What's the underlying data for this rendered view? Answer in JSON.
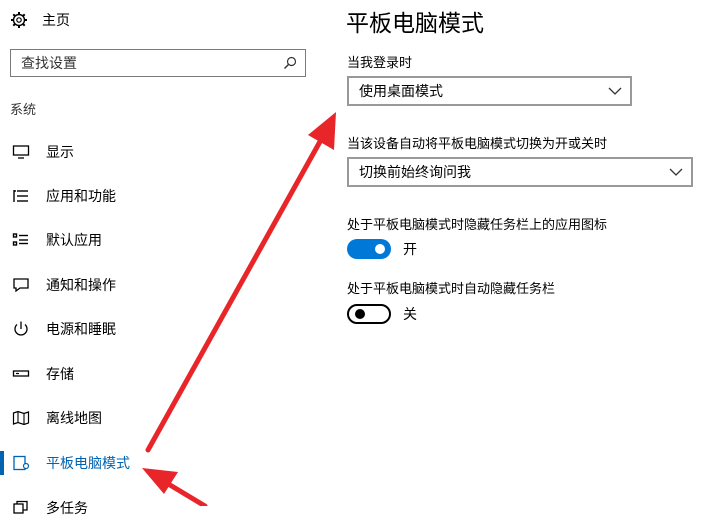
{
  "sidebar": {
    "home_label": "主页",
    "search_placeholder": "查找设置",
    "section_label": "系统",
    "items": [
      {
        "label": "显示",
        "icon": "monitor-icon"
      },
      {
        "label": "应用和功能",
        "icon": "list-icon"
      },
      {
        "label": "默认应用",
        "icon": "default-apps-icon"
      },
      {
        "label": "通知和操作",
        "icon": "chat-icon"
      },
      {
        "label": "电源和睡眠",
        "icon": "power-icon"
      },
      {
        "label": "存储",
        "icon": "storage-icon"
      },
      {
        "label": "离线地图",
        "icon": "map-icon"
      },
      {
        "label": "平板电脑模式",
        "icon": "tablet-icon",
        "active": true
      },
      {
        "label": "多任务",
        "icon": "multitask-icon"
      }
    ]
  },
  "main": {
    "title": "平板电脑模式",
    "login_label": "当我登录时",
    "login_value": "使用桌面模式",
    "switch_label": "当该设备自动将平板电脑模式切换为开或关时",
    "switch_value": "切换前始终询问我",
    "hide_icons_label": "处于平板电脑模式时隐藏任务栏上的应用图标",
    "hide_icons_state": "开",
    "hide_icons_on": true,
    "auto_hide_label": "处于平板电脑模式时自动隐藏任务栏",
    "auto_hide_state": "关",
    "auto_hide_on": false
  },
  "colors": {
    "accent": "#0063b1",
    "toggle_on": "#0078d7",
    "annotation_arrow": "#e8262a"
  }
}
